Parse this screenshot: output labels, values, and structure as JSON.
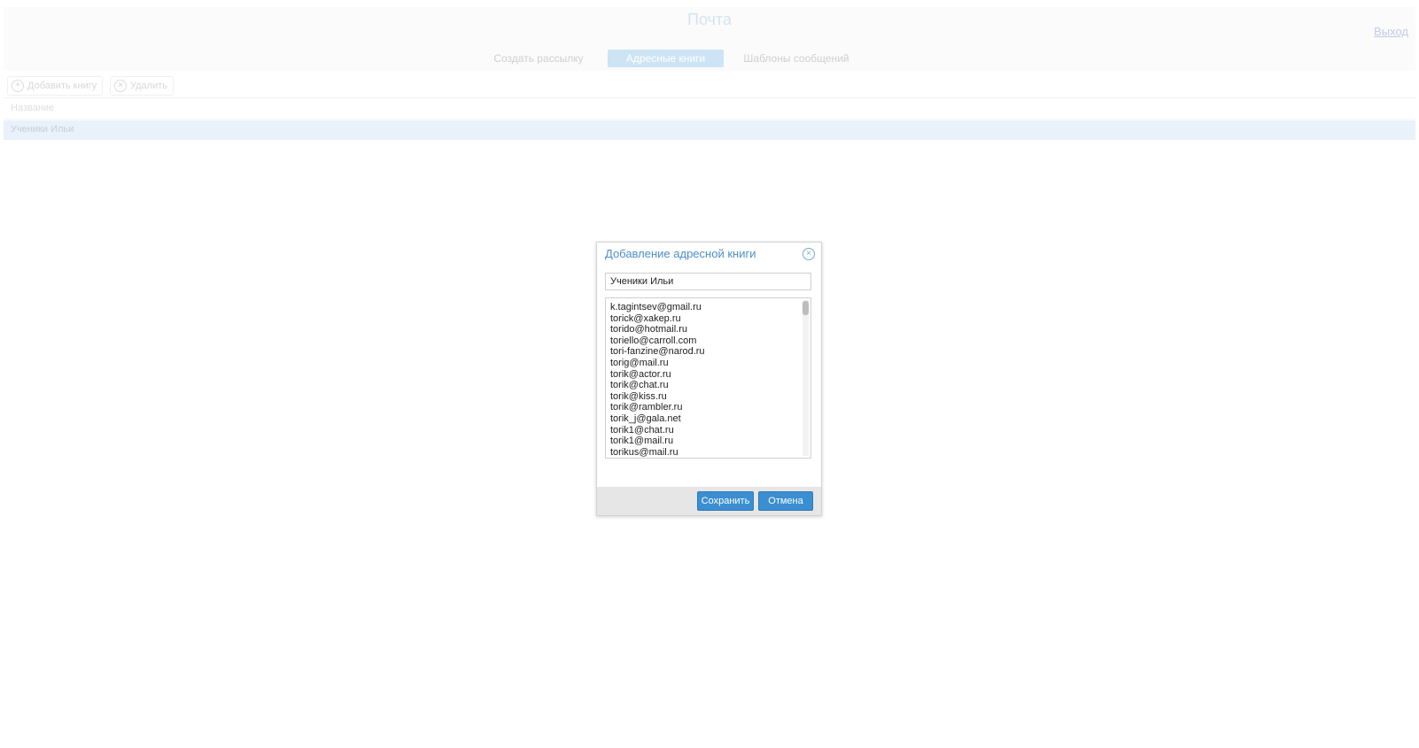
{
  "header": {
    "app_title": "Почта",
    "logout_label": "Выход",
    "tabs": [
      {
        "label": "Создать рассылку",
        "active": false
      },
      {
        "label": "Адресные книги",
        "active": true
      },
      {
        "label": "Шаблоны сообщений",
        "active": false
      }
    ]
  },
  "toolbar": {
    "add_book_label": "Добавить книгу",
    "delete_label": "Удалить"
  },
  "grid": {
    "column_name": "Название",
    "rows": [
      {
        "name": "Ученики Ильи",
        "selected": true
      }
    ]
  },
  "dialog": {
    "title": "Добавление адресной книги",
    "name_value": "Ученики Ильи",
    "emails": [
      "k.tagintsev@gmail.ru",
      "torick@xakep.ru",
      "torido@hotmail.ru",
      "toriello@carroll.com",
      "tori-fanzine@narod.ru",
      "torig@mail.ru",
      "torik@actor.ru",
      "torik@chat.ru",
      "torik@kiss.ru",
      "torik@rambler.ru",
      "torik_j@gala.net",
      "torik1@chat.ru",
      "torik1@mail.ru",
      "torikus@mail.ru"
    ],
    "save_label": "Сохранить",
    "cancel_label": "Отмена"
  },
  "colors": {
    "accent": "#3b8ed1",
    "dialog_title": "#4d8fc6",
    "selected_row": "#e9f2fa"
  }
}
